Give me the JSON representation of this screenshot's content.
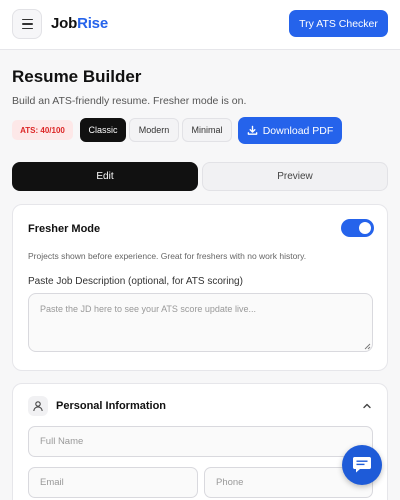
{
  "header": {
    "brand_part1": "Job",
    "brand_part2": "Rise",
    "ats_button": "Try ATS Checker",
    "brand_accent": "#2563eb"
  },
  "page": {
    "title": "Resume Builder",
    "subtitle": "Build an ATS-friendly resume. Fresher mode is on."
  },
  "toolbar": {
    "ats_score": "ATS: 40/100",
    "templates": [
      "Classic",
      "Modern",
      "Minimal"
    ],
    "active_template": "Classic",
    "download": "Download PDF"
  },
  "tabs": {
    "edit": "Edit",
    "preview": "Preview",
    "active": "Edit"
  },
  "fresher": {
    "title": "Fresher Mode",
    "enabled": true,
    "description": "Projects shown before experience. Great for freshers with no work history.",
    "jd_label": "Paste Job Description (optional, for ATS scoring)",
    "jd_placeholder": "Paste the JD here to see your ATS score update live..."
  },
  "personal": {
    "title": "Personal Information",
    "icon": "person-icon",
    "full_name_placeholder": "Full Name",
    "email_placeholder": "Email",
    "phone_placeholder": "Phone"
  },
  "chat": {
    "icon": "chat-icon"
  }
}
